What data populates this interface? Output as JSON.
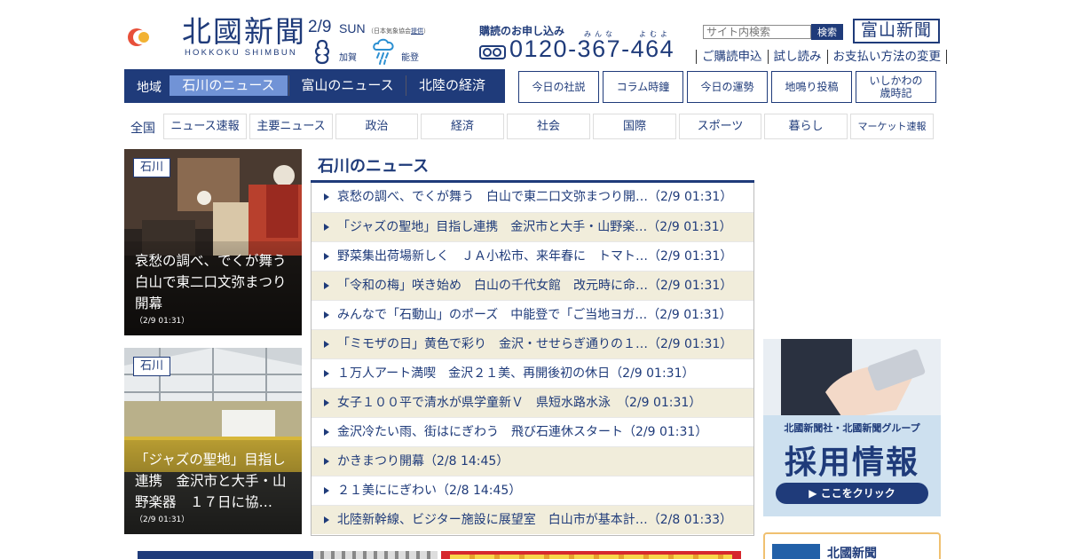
{
  "header": {
    "logo_jp": "北國新聞",
    "logo_en": "HOKKOKU SHIMBUN",
    "date": "2/9",
    "day": "SUN",
    "weather_credit_prefix": "（日本気象協会",
    "weather_credit_link": "提供",
    "weather_credit_suffix": "）",
    "weather_a_label": "加賀",
    "weather_b_label": "能登",
    "weather_a_icon": "cloudy-icon",
    "weather_b_icon": "rain-icon",
    "subscribe_title": "購読のお申し込み",
    "ruby_a": "みんな",
    "ruby_b": "よむよ",
    "tel": "0120-367-464",
    "search_placeholder": "サイト内検索",
    "search_button": "検索",
    "toyama_button": "富山新聞",
    "links": [
      "ご購読申込",
      "試し読み",
      "お支払い方法の変更"
    ]
  },
  "region_nav": {
    "label": "地域",
    "tabs": [
      "石川のニュース",
      "富山のニュース",
      "北陸の経済"
    ],
    "active_index": 0
  },
  "feature_buttons": [
    "今日の社説",
    "コラム時鐘",
    "今日の運勢",
    "地鳴り投稿",
    "いしかわの\n歳時記"
  ],
  "category_nav": {
    "label": "全国",
    "items": [
      "ニュース速報",
      "主要ニュース",
      "政治",
      "経済",
      "社会",
      "国際",
      "スポーツ",
      "暮らし",
      "マーケット速報"
    ]
  },
  "photos": [
    {
      "tag": "石川",
      "caption": "哀愁の調べ、でくが舞う　白山で東二口文弥まつり開幕",
      "time": "（2/9 01:31）"
    },
    {
      "tag": "石川",
      "caption": "「ジャズの聖地」目指し連携　金沢市と大手・山野楽器　１７日に協…",
      "time": "（2/9 01:31）"
    }
  ],
  "news": {
    "heading": "石川のニュース",
    "items": [
      "哀愁の調べ、でくが舞う　白山で東二口文弥まつり開…（2/9 01:31）",
      "「ジャズの聖地」目指し連携　金沢市と大手・山野楽…（2/9 01:31）",
      "野菜集出荷場新しく　ＪＡ小松市、来年春に　トマト…（2/9 01:31）",
      "「令和の梅」咲き始め　白山の千代女館　改元時に命…（2/9 01:31）",
      "みんなで「石動山」のポーズ　中能登で「ご当地ヨガ…（2/9 01:31）",
      "「ミモザの日」黄色で彩り　金沢・せせらぎ通りの１…（2/9 01:31）",
      "１万人アート満喫　金沢２１美、再開後初の休日（2/9 01:31）",
      "女子１００平で清水が県学童新Ｖ　県短水路水泳　（2/9 01:31）",
      "金沢冷たい雨、街はにぎわう　飛び石連休スタート（2/9 01:31）",
      "かきまつり開幕（2/8 14:45）",
      "２１美ににぎわい（2/8 14:45）",
      "北陸新幹線、ビジター施設に展望室　白山市が基本計…（2/8 01:33）"
    ]
  },
  "ads": {
    "recruit_line1": "北國新聞社・北國新聞グループ",
    "recruit_line2": "採用情報",
    "recruit_button": "▶ ここをクリック",
    "corp_logo_text": "北國新聞",
    "corp_name": "北國新聞"
  },
  "colors": {
    "brand_navy": "#1f3b7a",
    "active_tab": "#7193d6",
    "zebra": "#f1eddb"
  }
}
